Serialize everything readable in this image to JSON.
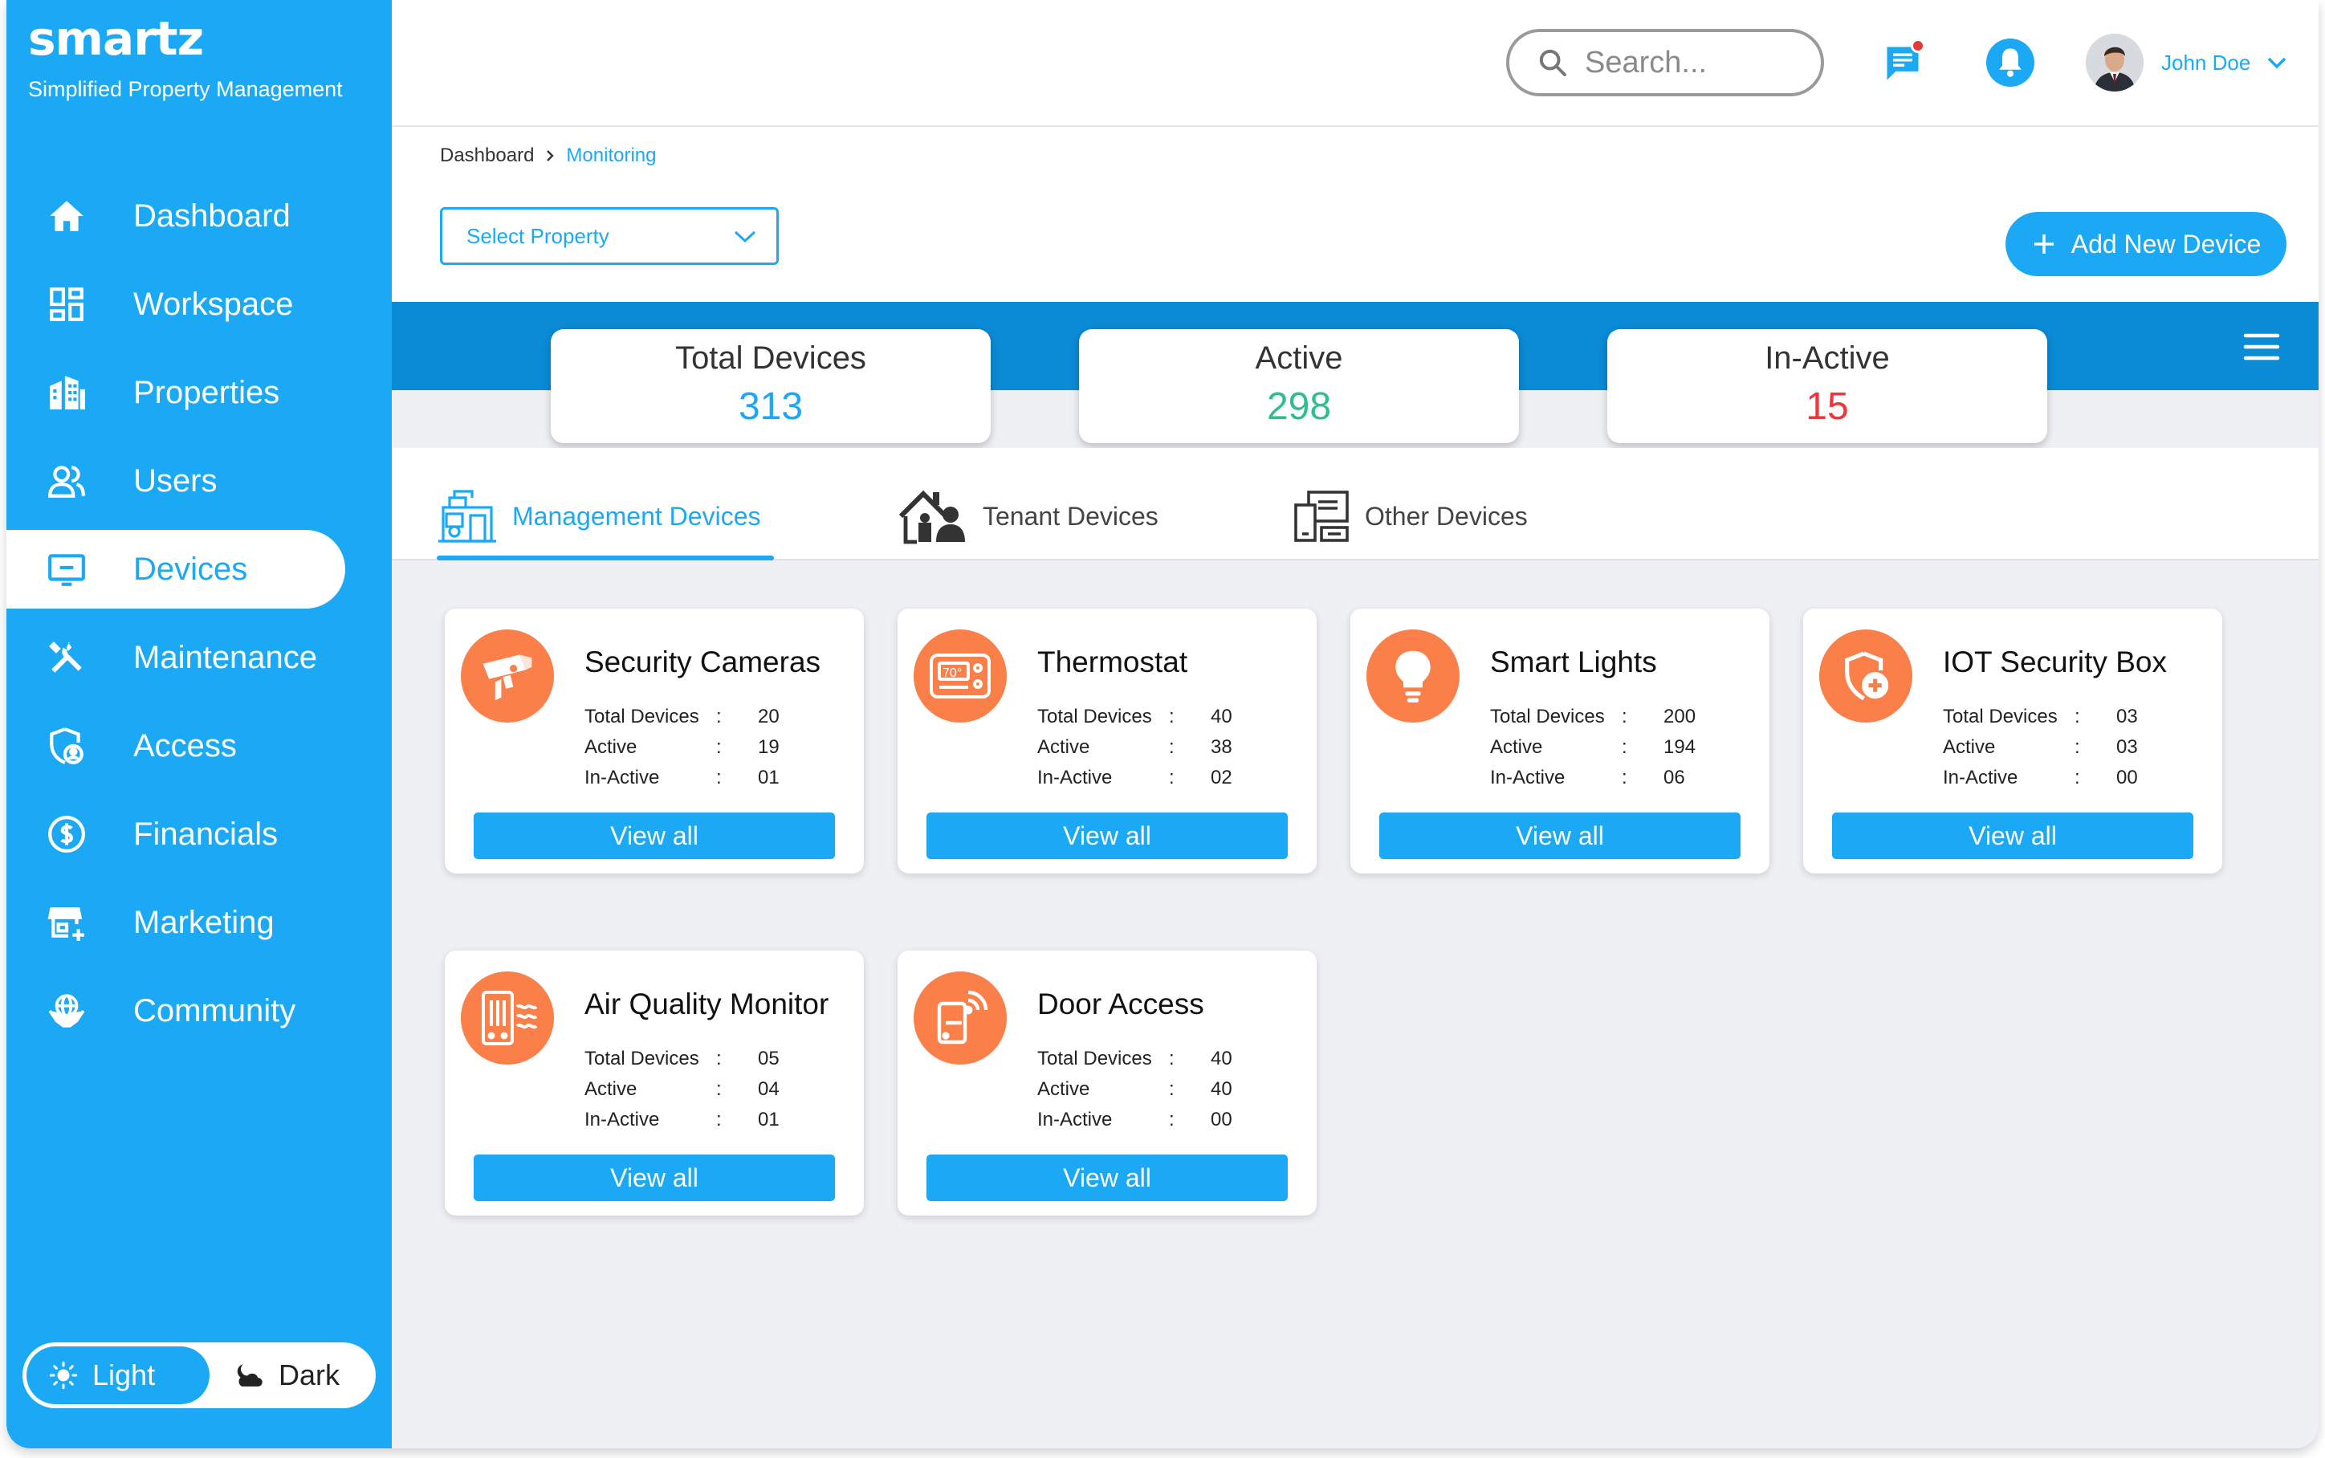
{
  "brand": {
    "name": "smartz",
    "tagline": "Simplified Property Management"
  },
  "sidebar": {
    "items": [
      {
        "label": "Dashboard",
        "icon": "home-icon"
      },
      {
        "label": "Workspace",
        "icon": "grid-icon"
      },
      {
        "label": "Properties",
        "icon": "buildings-icon"
      },
      {
        "label": "Users",
        "icon": "users-icon"
      },
      {
        "label": "Devices",
        "icon": "monitor-icon",
        "active": true
      },
      {
        "label": "Maintenance",
        "icon": "tools-icon"
      },
      {
        "label": "Access",
        "icon": "shield-user-icon"
      },
      {
        "label": "Financials",
        "icon": "dollar-icon"
      },
      {
        "label": "Marketing",
        "icon": "store-icon"
      },
      {
        "label": "Community",
        "icon": "globe-hands-icon"
      }
    ],
    "theme": {
      "light": "Light",
      "dark": "Dark"
    }
  },
  "header": {
    "search_placeholder": "Search...",
    "user_name": "John Doe"
  },
  "breadcrumb": {
    "root": "Dashboard",
    "current": "Monitoring"
  },
  "toolbar": {
    "select_property": "Select Property",
    "add_device": "Add New Device"
  },
  "stats": {
    "total": {
      "label": "Total Devices",
      "value": "313",
      "color": "#1ba9f5"
    },
    "active": {
      "label": "Active",
      "value": "298",
      "color": "#2dbf8f"
    },
    "inactive": {
      "label": "In-Active",
      "value": "15",
      "color": "#f0353d"
    }
  },
  "tabs": [
    {
      "label": "Management Devices",
      "active": true
    },
    {
      "label": "Tenant Devices"
    },
    {
      "label": "Other Devices"
    }
  ],
  "labels": {
    "total": "Total Devices",
    "active": "Active",
    "inactive": "In-Active",
    "colon": ":",
    "view_all": "View all"
  },
  "devices": [
    {
      "title": "Security Cameras",
      "icon": "camera-icon",
      "total": "20",
      "active": "19",
      "inactive": "01"
    },
    {
      "title": "Thermostat",
      "icon": "thermostat-icon",
      "thermo_reading": "70°",
      "total": "40",
      "active": "38",
      "inactive": "02"
    },
    {
      "title": "Smart Lights",
      "icon": "bulb-icon",
      "total": "200",
      "active": "194",
      "inactive": "06"
    },
    {
      "title": "IOT Security Box",
      "icon": "shield-plus-icon",
      "total": "03",
      "active": "03",
      "inactive": "00"
    },
    {
      "title": "Air Quality Monitor",
      "icon": "air-quality-icon",
      "total": "05",
      "active": "04",
      "inactive": "01"
    },
    {
      "title": "Door Access",
      "icon": "door-access-icon",
      "total": "40",
      "active": "40",
      "inactive": "00"
    }
  ],
  "colors": {
    "primary": "#1ba9f5",
    "bar": "#0b8ad6",
    "accent": "#fb7f48"
  }
}
